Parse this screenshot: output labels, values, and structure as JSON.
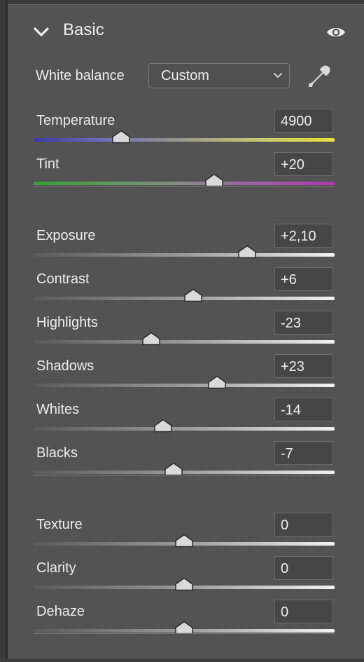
{
  "panel": {
    "title": "Basic",
    "white_balance": {
      "label": "White balance",
      "value": "Custom"
    },
    "groups": [
      [
        {
          "key": "temperature",
          "label": "Temperature",
          "value": "4900",
          "position": 0.29,
          "gradient": "linear-gradient(90deg,#3a3aa8 0%,#6c6cbc 22%,#909090 45%,#c8c870 75%,#e6e23a 100%)"
        },
        {
          "key": "tint",
          "label": "Tint",
          "value": "+20",
          "position": 0.6,
          "gradient": "linear-gradient(90deg,#35a335 0%,#5e9a5e 25%,#8a8a8a 50%,#a05aa6 78%,#b035b8 100%)"
        }
      ],
      [
        {
          "key": "exposure",
          "label": "Exposure",
          "value": "+2,10",
          "position": 0.71
        },
        {
          "key": "contrast",
          "label": "Contrast",
          "value": "+6",
          "position": 0.53
        },
        {
          "key": "highlights",
          "label": "Highlights",
          "value": "-23",
          "position": 0.39
        },
        {
          "key": "shadows",
          "label": "Shadows",
          "value": "+23",
          "position": 0.61
        },
        {
          "key": "whites",
          "label": "Whites",
          "value": "-14",
          "position": 0.43
        },
        {
          "key": "blacks",
          "label": "Blacks",
          "value": "-7",
          "position": 0.465
        }
      ],
      [
        {
          "key": "texture",
          "label": "Texture",
          "value": "0",
          "position": 0.5
        },
        {
          "key": "clarity",
          "label": "Clarity",
          "value": "0",
          "position": 0.5
        },
        {
          "key": "dehaze",
          "label": "Dehaze",
          "value": "0",
          "position": 0.5
        }
      ]
    ],
    "neutral_gradient": "linear-gradient(90deg,#5a5a5a 0%,#9a9a9a 50%,#f2f2f2 100%)"
  }
}
